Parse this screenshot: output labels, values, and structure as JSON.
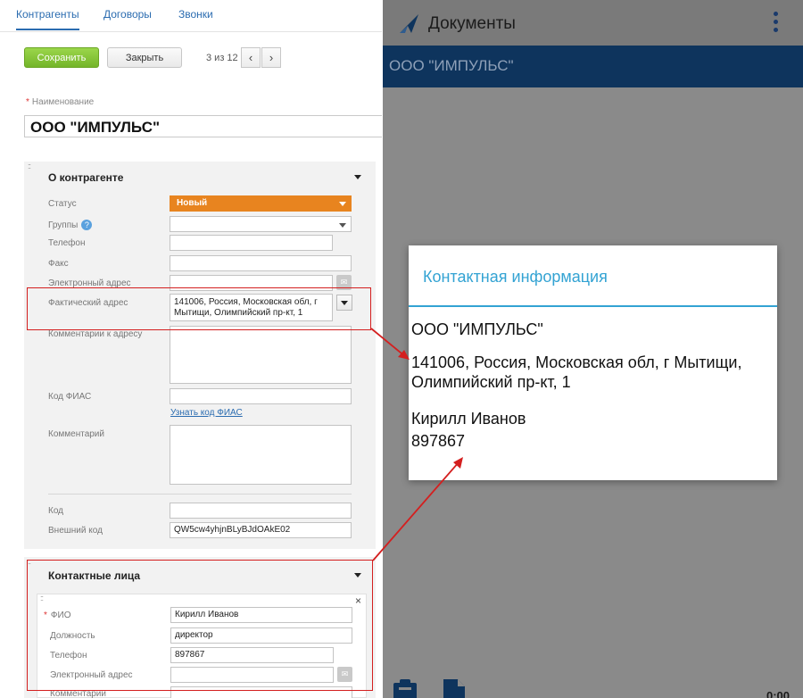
{
  "crm": {
    "tabs": [
      "Контрагенты",
      "Договоры",
      "Звонки"
    ],
    "toolbar": {
      "save_label": "Сохранить",
      "close_label": "Закрыть",
      "pager_text": "3 из 12",
      "prev_icon": "‹",
      "next_icon": "›"
    },
    "name_label": "Наименование",
    "name_value": "ООО \"ИМПУЛЬС\"",
    "about": {
      "title": "О контрагенте",
      "status_label": "Статус",
      "status_value": "Новый",
      "status_color": "#e8841f",
      "groups_label": "Группы",
      "phone_label": "Телефон",
      "fax_label": "Факс",
      "email_label": "Электронный адрес",
      "address_label": "Фактический адрес",
      "address_value": "141006, Россия, Московская обл, г Мытищи, Олимпийский пр-кт, 1",
      "address_comment_label": "Комментарии к адресу",
      "fias_label": "Код ФИАС",
      "fias_link": "Узнать код ФИАС",
      "comment_label": "Комментарий",
      "code_label": "Код",
      "ext_code_label": "Внешний код",
      "ext_code_value": "QW5cw4yhjnBLyBJdOAkE02"
    },
    "contacts": {
      "title": "Контактные лица",
      "fio_label": "ФИО",
      "fio_value": "Кирилл Иванов",
      "position_label": "Должность",
      "position_value": "директор",
      "phone_label": "Телефон",
      "phone_value": "897867",
      "email_label": "Электронный адрес",
      "comment_label": "Комментарии"
    }
  },
  "mobile": {
    "app_title": "Документы",
    "subtitle": "ООО \"ИМПУЛЬС\"",
    "time": "0:00",
    "dialog": {
      "title": "Контактная информация",
      "company": "ООО \"ИМПУЛЬС\"",
      "address_line1": "141006, Россия, Московская обл, г Мытищи,",
      "address_line2": "Олимпийский пр-кт, 1",
      "contact_name": "Кирилл Иванов",
      "contact_phone": "897867"
    }
  },
  "colors": {
    "accent": "#33a3d3",
    "annotation": "#d41f1f",
    "save_green": "#74b52a",
    "mobile_header": "#0e345d"
  }
}
